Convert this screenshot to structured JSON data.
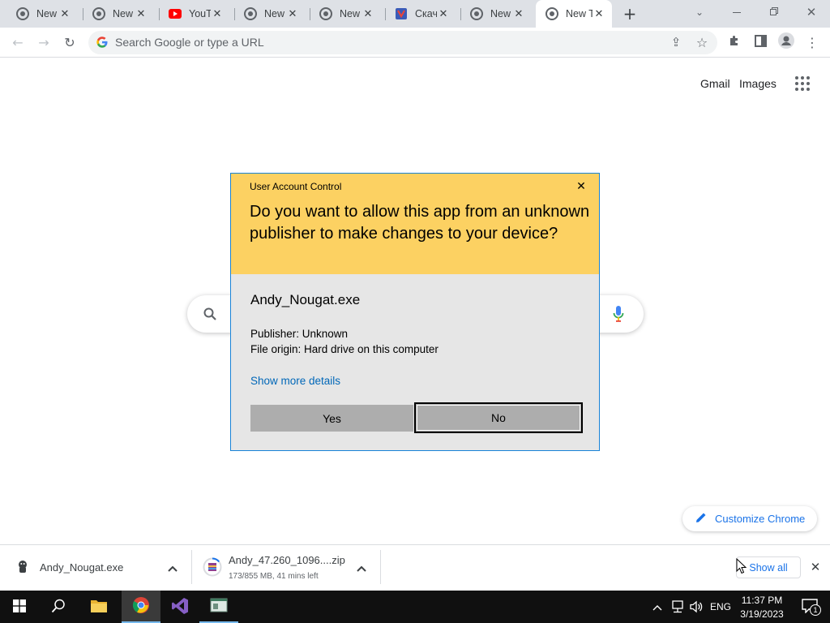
{
  "tabs": [
    {
      "title": "New Tab",
      "icon": "chrome-icon"
    },
    {
      "title": "New Tab",
      "icon": "chrome-icon"
    },
    {
      "title": "YouTube",
      "icon": "youtube-icon"
    },
    {
      "title": "New Tab",
      "icon": "chrome-icon"
    },
    {
      "title": "New Tab",
      "icon": "chrome-icon"
    },
    {
      "title": "Скачать",
      "icon": "site-icon"
    },
    {
      "title": "New Tab",
      "icon": "chrome-icon"
    },
    {
      "title": "New Tab",
      "icon": "chrome-icon",
      "active": true
    }
  ],
  "omnibox": {
    "placeholder": "Search Google or type a URL"
  },
  "ntp": {
    "gmail": "Gmail",
    "images": "Images",
    "customize": "Customize Chrome"
  },
  "uac": {
    "title": "User Account Control",
    "question": "Do you want to allow this app from an unknown publisher to make changes to your device?",
    "app_name": "Andy_Nougat.exe",
    "publisher": "Publisher: Unknown",
    "origin": "File origin: Hard drive on this computer",
    "more_details": "Show more details",
    "yes": "Yes",
    "no": "No"
  },
  "downloads": {
    "items": [
      {
        "name": "Andy_Nougat.exe",
        "status": ""
      },
      {
        "name": "Andy_47.260_1096....zip",
        "status": "173/855 MB, 41 mins left"
      }
    ],
    "show_all": "Show all"
  },
  "taskbar": {
    "language": "ENG",
    "time": "11:37 PM",
    "date": "3/19/2023",
    "notification_count": "1"
  },
  "colors": {
    "uac_header": "#fcd162",
    "uac_body": "#e6e6e6",
    "link_blue": "#0067b8",
    "chrome_blue": "#1a73e8",
    "taskbar": "#101010"
  }
}
